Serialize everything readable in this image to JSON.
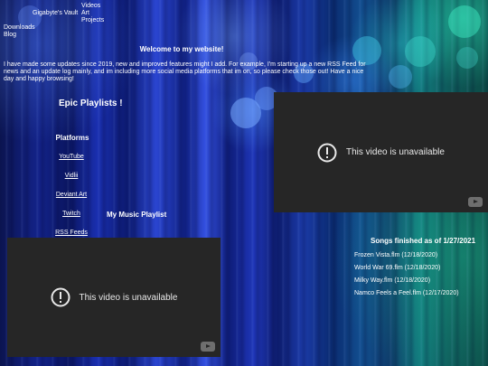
{
  "nav": {
    "vault": "Gigabyte's Vault",
    "videos": "Videos",
    "art": "Art",
    "projects": "Projects",
    "downloads": "Downloads",
    "blog": "Blog"
  },
  "welcome": {
    "title": "Welcome to my website!",
    "body_line1": "I have made some updates since 2019, new and improved features might I add. For example, I'm starting up a new RSS Feed for",
    "body_line2": "news and an update log mainly, and im including more social media platforms that im on, so please check those out! Have a nice",
    "body_line3": "day and happy browsing!"
  },
  "playlists_title": "Epic Playlists !",
  "platforms": {
    "title": "Platforms",
    "items": [
      "YouTube",
      "Vidlii",
      "Deviant Art",
      "Twitch",
      "RSS Feeds"
    ]
  },
  "music_playlist_title": "My Music Playlist",
  "videos": [
    {
      "message": "This video is unavailable",
      "icon": "exclamation-circle-icon"
    },
    {
      "message": "This video is unavailable",
      "icon": "exclamation-circle-icon"
    }
  ],
  "songs": {
    "title": "Songs finished as of 1/27/2021",
    "items": [
      "Frozen Vista.flm (12/18/2020)",
      "World War 69.flm (12/18/2020)",
      "Milky Way.flm (12/18/2020)",
      "Namco Feels a Feel.flm (12/17/2020)"
    ]
  },
  "colors": {
    "video_bg": "#262626",
    "text": "#ffffff"
  }
}
